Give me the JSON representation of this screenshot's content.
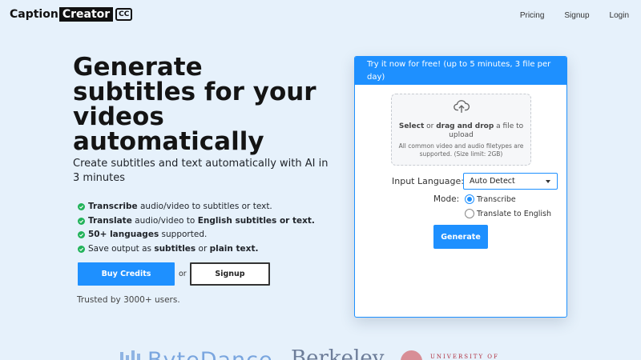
{
  "brand": {
    "part1": "Caption",
    "part2": "Creator",
    "badge": "CC"
  },
  "nav": {
    "links": [
      "Pricing",
      "Signup",
      "Login"
    ]
  },
  "hero": {
    "title": "Generate subtitles for your videos automatically",
    "subtitle": "Create subtitles and text automatically with AI in 3 minutes",
    "features": [
      {
        "bold": "Transcribe",
        "text": " audio/video to subtitles or text."
      },
      {
        "bold": "Translate",
        "text": " audio/video to ",
        "bold2": "English subtitles or text."
      },
      {
        "bold": "50+ languages",
        "text": " supported."
      },
      {
        "pre": "Save output as ",
        "bold": "subtitles",
        "text": " or ",
        "bold2": "plain text."
      }
    ],
    "buy_label": "Buy Credits",
    "or_label": "or",
    "signup_label": "Signup",
    "trusted": "Trusted by 3000+ users."
  },
  "card": {
    "header": "Try it now for free! (up to 5 minutes, 3 file per day)",
    "dropzone": {
      "select": "Select",
      "or": " or ",
      "drag": "drag and drop",
      "rest": " a file to upload",
      "hint": "All common video and audio filetypes are supported. (Size limit: 2GB)"
    },
    "language_label": "Input Language:",
    "language_value": "Auto Detect",
    "mode_label": "Mode:",
    "modes": [
      {
        "label": "Transcribe",
        "selected": true
      },
      {
        "label": "Translate to English",
        "selected": false
      }
    ],
    "generate_label": "Generate"
  },
  "logos": {
    "items": [
      "ByteDance",
      "Berkeley",
      "UNIVERSITY OF"
    ]
  },
  "colors": {
    "accent": "#1e90ff",
    "check": "#22b35a",
    "background": "#e6f1fb"
  }
}
